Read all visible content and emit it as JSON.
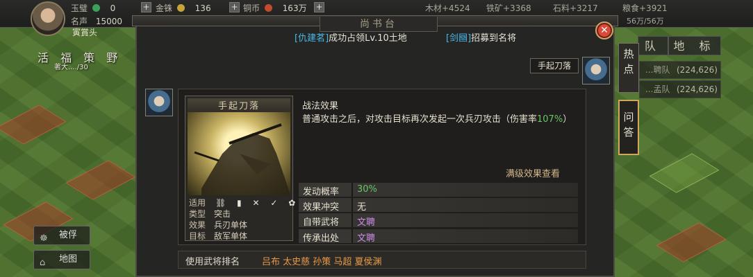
{
  "topbar": {
    "stat_jade_label": "玉璧",
    "stat_jade_value": "0",
    "stat_gold_label": "金铢",
    "stat_gold_value": "136",
    "stat_copper_label": "铜币",
    "stat_copper_value": "163万",
    "reputation_label": "名声",
    "reputation_value": "15000",
    "player_name": "寅賞头",
    "res_wood": "木材+4524",
    "res_iron": "铁矿+3368",
    "res_stone": "石料+3217",
    "res_food": "粮食+3921",
    "food_cap": "56万/56万"
  },
  "map_labels": {
    "row": "活 福 策 野",
    "sub": "著大..../30"
  },
  "side_buttons": {
    "captive": "被俘",
    "map": "地图"
  },
  "panel": {
    "title": "尚书台",
    "notice_left_tag": "[仇建茗]",
    "notice_left_text": "成功占领Lv.10土地",
    "notice_right_tag": "[剑圝]",
    "notice_right_text": "招募到名将"
  },
  "right_tabs": {
    "hot": "热点",
    "qa": "问答",
    "team_tab": "队",
    "territory_tab": "地 标",
    "row1_label": "...聘队",
    "row1_value": "(224,626)",
    "row2_label": "...孟队",
    "row2_value": "(224,626)"
  },
  "chat": {
    "bubble": "手起刀落"
  },
  "skill": {
    "name": "手起刀落",
    "attrs": {
      "use_label": "适用",
      "use_icons": "⛓ ▮ ✕ ✓ ✿",
      "type_label": "类型",
      "type_value": "突击",
      "effect_label": "效果",
      "effect_value": "兵刃单体",
      "target_label": "目标",
      "target_value": "敌军单体"
    },
    "effect_title": "战法效果",
    "effect_text_pre": "普通攻击之后，对攻击目标再次发起一次兵刃攻击（伤害率",
    "effect_text_pct": "107%",
    "effect_text_post": "）",
    "max_link": "满级效果查看",
    "info": [
      {
        "key": "发动概率",
        "value": "30%",
        "color": "#6ac468"
      },
      {
        "key": "效果冲突",
        "value": "无",
        "color": "#e6e0d0"
      },
      {
        "key": "自带武将",
        "value": "文聘",
        "color": "#c98ce6"
      },
      {
        "key": "传承出处",
        "value": "文聘",
        "color": "#c98ce6"
      }
    ],
    "usage_label": "使用武将排名",
    "usage_names": "吕布 太史慈 孙策 马超 夏侯渊"
  },
  "colors": {
    "accent_gold": "#d2a85c",
    "tag_blue": "#49b8e6",
    "name_orange": "#e89a48",
    "purple": "#c98ce6",
    "green": "#6ac468"
  }
}
